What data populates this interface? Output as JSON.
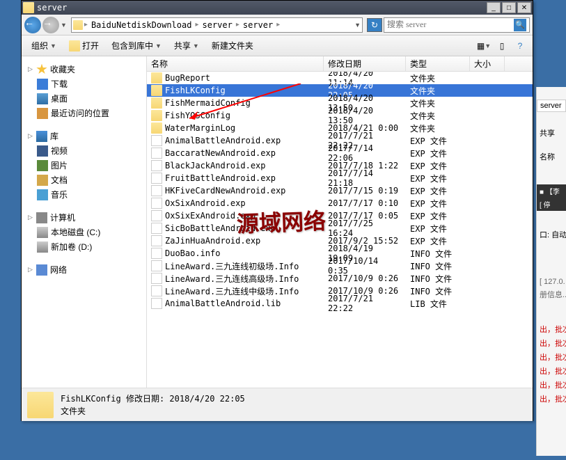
{
  "window": {
    "title": "server"
  },
  "breadcrumb": {
    "parts": [
      "BaiduNetdiskDownload",
      "server",
      "server"
    ]
  },
  "search": {
    "placeholder": "搜索 server"
  },
  "toolbar": {
    "organize": "组织",
    "open": "打开",
    "include": "包含到库中",
    "share": "共享",
    "new_folder": "新建文件夹"
  },
  "sidebar": {
    "favorites": "收藏夹",
    "downloads": "下载",
    "desktop": "桌面",
    "recent": "最近访问的位置",
    "library": "库",
    "video": "视频",
    "pictures": "图片",
    "documents": "文档",
    "music": "音乐",
    "computer": "计算机",
    "disk_c": "本地磁盘 (C:)",
    "disk_d": "新加卷 (D:)",
    "network": "网络"
  },
  "columns": {
    "name": "名称",
    "date": "修改日期",
    "type": "类型",
    "size": "大小"
  },
  "files": [
    {
      "name": "BugReport",
      "date": "2018/4/20 11:14",
      "type": "文件夹",
      "icon": "folder"
    },
    {
      "name": "FishLKConfig",
      "date": "2018/4/20 22:05",
      "type": "文件夹",
      "icon": "folder",
      "selected": true
    },
    {
      "name": "FishMermaidConfig",
      "date": "2018/4/20 13:50",
      "type": "文件夹",
      "icon": "folder"
    },
    {
      "name": "FishYQSConfig",
      "date": "2018/4/20 13:50",
      "type": "文件夹",
      "icon": "folder"
    },
    {
      "name": "WaterMarginLog",
      "date": "2018/4/21 0:00",
      "type": "文件夹",
      "icon": "folder"
    },
    {
      "name": "AnimalBattleAndroid.exp",
      "date": "2017/7/21 22:22",
      "type": "EXP 文件",
      "icon": "file"
    },
    {
      "name": "BaccaratNewAndroid.exp",
      "date": "2017/7/14 22:06",
      "type": "EXP 文件",
      "icon": "file"
    },
    {
      "name": "BlackJackAndroid.exp",
      "date": "2017/7/18 1:22",
      "type": "EXP 文件",
      "icon": "file"
    },
    {
      "name": "FruitBattleAndroid.exp",
      "date": "2017/7/14 21:18",
      "type": "EXP 文件",
      "icon": "file"
    },
    {
      "name": "HKFiveCardNewAndroid.exp",
      "date": "2017/7/15 0:19",
      "type": "EXP 文件",
      "icon": "file"
    },
    {
      "name": "OxSixAndroid.exp",
      "date": "2017/7/17 0:10",
      "type": "EXP 文件",
      "icon": "file"
    },
    {
      "name": "OxSixExAndroid.exp",
      "date": "2017/7/17 0:05",
      "type": "EXP 文件",
      "icon": "file"
    },
    {
      "name": "SicBoBattleAndroid.exp",
      "date": "2017/7/25 16:24",
      "type": "EXP 文件",
      "icon": "file"
    },
    {
      "name": "ZaJinHuaAndroid.exp",
      "date": "2017/9/2 15:52",
      "type": "EXP 文件",
      "icon": "file"
    },
    {
      "name": "DuoBao.info",
      "date": "2018/4/19 19:09",
      "type": "INFO 文件",
      "icon": "file"
    },
    {
      "name": "LineAward.三九连线初级场.Info",
      "date": "2017/10/14 0:35",
      "type": "INFO 文件",
      "icon": "file"
    },
    {
      "name": "LineAward.三九连线高级场.Info",
      "date": "2017/10/9 0:26",
      "type": "INFO 文件",
      "icon": "file"
    },
    {
      "name": "LineAward.三九连线中级场.Info",
      "date": "2017/10/9 0:26",
      "type": "INFO 文件",
      "icon": "file"
    },
    {
      "name": "AnimalBattleAndroid.lib",
      "date": "2017/7/21 22:22",
      "type": "LIB 文件",
      "icon": "file"
    }
  ],
  "status": {
    "name": "FishLKConfig",
    "date_label": "修改日期:",
    "date": "2018/4/20 22:05",
    "type": "文件夹"
  },
  "watermark": "源域网络",
  "side": {
    "server_tab": "server",
    "share": "共享",
    "name_col": "名称",
    "stop": "[ 停",
    "auto": "自动",
    "ip": "[ 127.0.",
    "info": "册信息...",
    "batch": "出，批次"
  }
}
